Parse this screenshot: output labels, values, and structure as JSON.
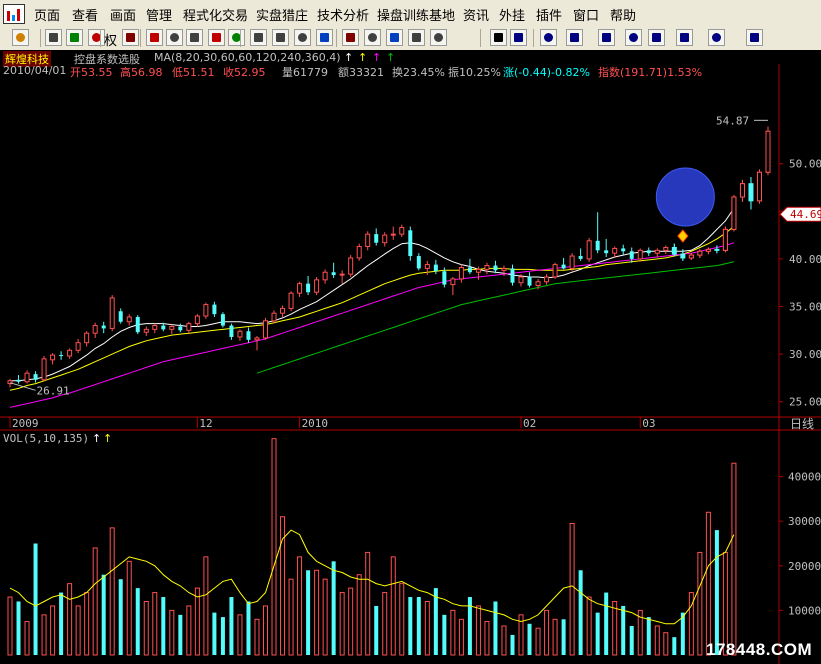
{
  "menu": [
    "页面",
    "查看",
    "画面",
    "管理",
    "程式化交易",
    "实盘猎庄",
    "技术分析",
    "操盘训练基地",
    "资讯",
    "外挂",
    "插件",
    "窗口",
    "帮助"
  ],
  "toolbar": {
    "quan_label": "权",
    "icons": [
      "open-folder-icon",
      "rsi-icon",
      "crosshair-icon",
      "arrows-icon",
      "weight-right-icon",
      "red-balls-icon",
      "glasses-icon",
      "number10-icon",
      "stop-icon",
      "flag-icon",
      "database-icon",
      "bar-chart-icon",
      "candlestick-icon",
      "info-icon",
      "worm-icon",
      "pen-icon",
      "grid-icon",
      "window-icon",
      "minimize-window-icon",
      "cursor-icon",
      "line-tool-icon",
      "text-tool-icon",
      "fib-tool-icon",
      "fan-tool-icon",
      "parallel-tool-icon",
      "channel-tool-icon",
      "rect-tool-icon",
      "ellipse-tool-icon",
      "more-tool-icon"
    ]
  },
  "header": {
    "stock_name": "辉煌科技",
    "indicator_name": "控盘系数选股",
    "ma_params": "MA(8,20,30,60,60,120,240,360,4)",
    "arrows": [
      "↑",
      "↑",
      "↑",
      "↑"
    ]
  },
  "info": {
    "date": "2010/04/01",
    "open": "开53.55",
    "high": "高56.98",
    "low": "低51.51",
    "close": "收52.95",
    "volume": "量61779",
    "amount": "额33321",
    "turnover": "换23.45%",
    "amplitude": "振10.25%",
    "change": "涨(-0.44)-0.82%",
    "index": "指数(191.71)1.53%"
  },
  "chart_data": {
    "type": "candlestick",
    "price_axis_ticks": [
      "50.00",
      "45.00",
      "40.00",
      "35.00",
      "30.00",
      "25.00"
    ],
    "price_ylim": [
      23.5,
      59
    ],
    "current_price_tag": "44.69",
    "high_label": "54.87",
    "low_label": "26.91",
    "date_labels": [
      "2009",
      "12",
      "2010",
      "02",
      "03"
    ],
    "period_label": "日线",
    "volume_title": "VOL(5,10,135)",
    "volume_arrows": [
      "↑",
      "↑"
    ],
    "volume_axis_ticks": [
      "40000",
      "30000",
      "20000",
      "10000"
    ],
    "volume_ylim": [
      0,
      50000
    ],
    "candles": [
      {
        "o": 26.9,
        "h": 27.4,
        "l": 26.5,
        "c": 27.2
      },
      {
        "o": 27.3,
        "h": 27.8,
        "l": 26.9,
        "c": 27.1
      },
      {
        "o": 27.1,
        "h": 28.3,
        "l": 26.9,
        "c": 28.0
      },
      {
        "o": 27.9,
        "h": 28.2,
        "l": 27.0,
        "c": 27.3
      },
      {
        "o": 27.3,
        "h": 29.8,
        "l": 27.2,
        "c": 29.5
      },
      {
        "o": 29.4,
        "h": 30.1,
        "l": 28.9,
        "c": 29.9
      },
      {
        "o": 29.9,
        "h": 30.3,
        "l": 29.4,
        "c": 29.8
      },
      {
        "o": 29.8,
        "h": 30.6,
        "l": 29.5,
        "c": 30.4
      },
      {
        "o": 30.4,
        "h": 31.6,
        "l": 30.1,
        "c": 31.2
      },
      {
        "o": 31.2,
        "h": 32.4,
        "l": 30.8,
        "c": 32.2
      },
      {
        "o": 32.2,
        "h": 33.3,
        "l": 31.7,
        "c": 33.0
      },
      {
        "o": 33.0,
        "h": 33.4,
        "l": 32.2,
        "c": 32.7
      },
      {
        "o": 32.7,
        "h": 36.2,
        "l": 32.4,
        "c": 35.9
      },
      {
        "o": 34.5,
        "h": 34.8,
        "l": 33.2,
        "c": 33.4
      },
      {
        "o": 33.4,
        "h": 34.2,
        "l": 33.0,
        "c": 33.9
      },
      {
        "o": 33.9,
        "h": 34.1,
        "l": 32.1,
        "c": 32.3
      },
      {
        "o": 32.3,
        "h": 32.9,
        "l": 31.9,
        "c": 32.6
      },
      {
        "o": 32.6,
        "h": 33.2,
        "l": 32.2,
        "c": 33.0
      },
      {
        "o": 33.0,
        "h": 33.3,
        "l": 32.4,
        "c": 32.6
      },
      {
        "o": 32.6,
        "h": 33.1,
        "l": 32.1,
        "c": 32.9
      },
      {
        "o": 32.9,
        "h": 33.2,
        "l": 32.3,
        "c": 32.5
      },
      {
        "o": 32.5,
        "h": 33.4,
        "l": 32.2,
        "c": 33.2
      },
      {
        "o": 33.2,
        "h": 34.2,
        "l": 32.9,
        "c": 34.0
      },
      {
        "o": 34.0,
        "h": 35.4,
        "l": 33.7,
        "c": 35.2
      },
      {
        "o": 35.2,
        "h": 35.5,
        "l": 33.9,
        "c": 34.2
      },
      {
        "o": 34.2,
        "h": 34.4,
        "l": 32.8,
        "c": 33.0
      },
      {
        "o": 33.0,
        "h": 33.2,
        "l": 31.5,
        "c": 31.8
      },
      {
        "o": 31.8,
        "h": 32.6,
        "l": 31.4,
        "c": 32.4
      },
      {
        "o": 32.4,
        "h": 32.8,
        "l": 31.2,
        "c": 31.5
      },
      {
        "o": 31.5,
        "h": 31.9,
        "l": 30.4,
        "c": 31.7
      },
      {
        "o": 31.7,
        "h": 33.8,
        "l": 31.5,
        "c": 33.5
      },
      {
        "o": 33.5,
        "h": 34.6,
        "l": 33.2,
        "c": 34.3
      },
      {
        "o": 34.3,
        "h": 35.1,
        "l": 33.9,
        "c": 34.8
      },
      {
        "o": 34.8,
        "h": 36.6,
        "l": 34.5,
        "c": 36.4
      },
      {
        "o": 36.4,
        "h": 37.6,
        "l": 36.0,
        "c": 37.4
      },
      {
        "o": 37.4,
        "h": 38.2,
        "l": 36.2,
        "c": 36.5
      },
      {
        "o": 36.5,
        "h": 38.1,
        "l": 36.2,
        "c": 37.8
      },
      {
        "o": 37.8,
        "h": 38.9,
        "l": 37.4,
        "c": 38.6
      },
      {
        "o": 38.6,
        "h": 39.6,
        "l": 38.0,
        "c": 38.3
      },
      {
        "o": 38.3,
        "h": 38.8,
        "l": 37.4,
        "c": 38.4
      },
      {
        "o": 38.4,
        "h": 40.4,
        "l": 38.1,
        "c": 40.1
      },
      {
        "o": 40.1,
        "h": 41.6,
        "l": 39.8,
        "c": 41.3
      },
      {
        "o": 41.3,
        "h": 42.9,
        "l": 40.9,
        "c": 42.6
      },
      {
        "o": 42.6,
        "h": 43.2,
        "l": 41.4,
        "c": 41.7
      },
      {
        "o": 41.7,
        "h": 42.8,
        "l": 41.3,
        "c": 42.5
      },
      {
        "o": 42.5,
        "h": 43.4,
        "l": 42.0,
        "c": 42.6
      },
      {
        "o": 42.6,
        "h": 43.6,
        "l": 42.3,
        "c": 43.3
      },
      {
        "o": 43.0,
        "h": 43.4,
        "l": 39.8,
        "c": 40.3
      },
      {
        "o": 40.3,
        "h": 40.6,
        "l": 38.8,
        "c": 39.0
      },
      {
        "o": 39.0,
        "h": 39.8,
        "l": 38.3,
        "c": 39.4
      },
      {
        "o": 39.4,
        "h": 39.9,
        "l": 38.4,
        "c": 38.7
      },
      {
        "o": 38.7,
        "h": 39.1,
        "l": 37.0,
        "c": 37.3
      },
      {
        "o": 37.3,
        "h": 38.1,
        "l": 36.2,
        "c": 37.9
      },
      {
        "o": 37.9,
        "h": 39.4,
        "l": 37.5,
        "c": 39.1
      },
      {
        "o": 39.1,
        "h": 40.0,
        "l": 38.4,
        "c": 38.6
      },
      {
        "o": 38.6,
        "h": 39.2,
        "l": 37.8,
        "c": 38.9
      },
      {
        "o": 38.9,
        "h": 39.6,
        "l": 38.4,
        "c": 39.3
      },
      {
        "o": 39.3,
        "h": 39.8,
        "l": 38.5,
        "c": 38.8
      },
      {
        "o": 38.8,
        "h": 39.3,
        "l": 38.2,
        "c": 39.0
      },
      {
        "o": 39.0,
        "h": 39.4,
        "l": 37.2,
        "c": 37.5
      },
      {
        "o": 37.5,
        "h": 38.4,
        "l": 37.1,
        "c": 38.1
      },
      {
        "o": 38.1,
        "h": 38.6,
        "l": 37.0,
        "c": 37.2
      },
      {
        "o": 37.2,
        "h": 37.9,
        "l": 36.8,
        "c": 37.6
      },
      {
        "o": 37.6,
        "h": 38.4,
        "l": 37.3,
        "c": 38.1
      },
      {
        "o": 38.1,
        "h": 39.6,
        "l": 37.9,
        "c": 39.4
      },
      {
        "o": 39.4,
        "h": 40.1,
        "l": 38.9,
        "c": 39.0
      },
      {
        "o": 39.0,
        "h": 40.6,
        "l": 38.7,
        "c": 40.3
      },
      {
        "o": 40.3,
        "h": 41.1,
        "l": 39.8,
        "c": 40.0
      },
      {
        "o": 40.0,
        "h": 42.2,
        "l": 39.7,
        "c": 41.9
      },
      {
        "o": 41.9,
        "h": 44.9,
        "l": 40.6,
        "c": 40.9
      },
      {
        "o": 40.9,
        "h": 42.1,
        "l": 40.2,
        "c": 40.6
      },
      {
        "o": 40.6,
        "h": 41.3,
        "l": 40.1,
        "c": 41.1
      },
      {
        "o": 41.1,
        "h": 41.5,
        "l": 40.4,
        "c": 40.8
      },
      {
        "o": 40.8,
        "h": 41.2,
        "l": 39.6,
        "c": 40.0
      },
      {
        "o": 40.0,
        "h": 41.1,
        "l": 39.7,
        "c": 40.9
      },
      {
        "o": 40.9,
        "h": 41.2,
        "l": 40.3,
        "c": 40.6
      },
      {
        "o": 40.6,
        "h": 41.1,
        "l": 40.2,
        "c": 40.9
      },
      {
        "o": 40.9,
        "h": 41.4,
        "l": 40.5,
        "c": 41.2
      },
      {
        "o": 41.2,
        "h": 41.6,
        "l": 40.3,
        "c": 40.5
      },
      {
        "o": 40.5,
        "h": 41.0,
        "l": 39.8,
        "c": 40.1
      },
      {
        "o": 40.1,
        "h": 40.6,
        "l": 39.9,
        "c": 40.4
      },
      {
        "o": 40.4,
        "h": 41.0,
        "l": 40.1,
        "c": 40.8
      },
      {
        "o": 40.8,
        "h": 41.2,
        "l": 40.5,
        "c": 41.0
      },
      {
        "o": 41.0,
        "h": 41.4,
        "l": 40.6,
        "c": 40.9
      },
      {
        "o": 40.9,
        "h": 43.4,
        "l": 40.7,
        "c": 43.1
      },
      {
        "o": 43.1,
        "h": 46.7,
        "l": 42.9,
        "c": 46.5
      },
      {
        "o": 46.5,
        "h": 48.3,
        "l": 46.0,
        "c": 47.9
      },
      {
        "o": 47.9,
        "h": 48.6,
        "l": 45.2,
        "c": 46.1
      },
      {
        "o": 46.1,
        "h": 49.4,
        "l": 45.8,
        "c": 49.1
      },
      {
        "o": 49.1,
        "h": 53.9,
        "l": 48.8,
        "c": 53.4
      }
    ],
    "ma_lines": [
      {
        "name": "MA8",
        "color": "#ffffff",
        "values": [
          27.2,
          27.2,
          27.3,
          27.4,
          27.6,
          27.9,
          28.3,
          28.7,
          29.3,
          29.9,
          30.6,
          31.1,
          31.8,
          32.4,
          32.8,
          33.1,
          33.2,
          33.2,
          33.2,
          33.1,
          33.0,
          32.9,
          32.9,
          33.0,
          33.2,
          33.4,
          33.4,
          33.4,
          33.3,
          33.2,
          33.3,
          33.5,
          33.8,
          34.2,
          34.7,
          35.1,
          35.5,
          36.1,
          36.7,
          37.3,
          37.9,
          38.6,
          39.3,
          39.9,
          40.5,
          41.1,
          41.6,
          41.7,
          41.5,
          41.1,
          40.6,
          40.1,
          39.7,
          39.4,
          39.2,
          38.9,
          38.7,
          38.6,
          38.5,
          38.3,
          38.2,
          38.1,
          38.1,
          38.0,
          38.1,
          38.3,
          38.6,
          38.9,
          39.3,
          39.6,
          39.9,
          40.2,
          40.4,
          40.6,
          40.7,
          40.8,
          40.8,
          40.8,
          40.8,
          40.8,
          40.9,
          41.4,
          42.2,
          43.1,
          44.0,
          45.3
        ]
      },
      {
        "name": "MA20",
        "color": "#ffff00",
        "values": [
          26.2,
          26.4,
          26.7,
          26.9,
          27.2,
          27.5,
          27.8,
          28.1,
          28.4,
          28.8,
          29.2,
          29.6,
          30.0,
          30.4,
          30.8,
          31.1,
          31.4,
          31.6,
          31.8,
          32.0,
          32.1,
          32.2,
          32.3,
          32.4,
          32.5,
          32.6,
          32.7,
          32.8,
          32.9,
          33.0,
          33.1,
          33.3,
          33.5,
          33.7,
          33.9,
          34.2,
          34.5,
          34.8,
          35.1,
          35.4,
          35.8,
          36.2,
          36.6,
          37.0,
          37.4,
          37.7,
          38.0,
          38.3,
          38.5,
          38.6,
          38.7,
          38.8,
          38.8,
          38.8,
          38.9,
          38.9,
          39.0,
          39.0,
          39.0,
          38.9,
          38.9,
          38.9,
          38.8,
          38.8,
          38.8,
          38.8,
          38.9,
          39.0,
          39.1,
          39.2,
          39.4,
          39.5,
          39.6,
          39.7,
          39.8,
          39.9,
          40.0,
          40.1,
          40.3,
          40.5,
          40.8,
          41.2,
          41.6,
          42.1,
          42.7,
          43.4
        ]
      },
      {
        "name": "MA60",
        "color": "#ff00ff",
        "values": [
          24.4,
          24.6,
          24.8,
          25.0,
          25.2,
          25.4,
          25.7,
          25.9,
          26.2,
          26.5,
          26.8,
          27.1,
          27.4,
          27.7,
          28.0,
          28.3,
          28.6,
          28.9,
          29.2,
          29.4,
          29.6,
          29.8,
          30.0,
          30.2,
          30.4,
          30.6,
          30.8,
          31.0,
          31.2,
          31.4,
          31.6,
          31.9,
          32.2,
          32.5,
          32.8,
          33.1,
          33.4,
          33.7,
          34.0,
          34.3,
          34.6,
          34.9,
          35.2,
          35.5,
          35.8,
          36.1,
          36.4,
          36.7,
          37.0,
          37.2,
          37.4,
          37.6,
          37.8,
          37.9,
          38.0,
          38.1,
          38.2,
          38.3,
          38.4,
          38.5,
          38.6,
          38.7,
          38.8,
          38.9,
          39.0,
          39.1,
          39.2,
          39.3,
          39.4,
          39.5,
          39.6,
          39.7,
          39.8,
          39.9,
          40.0,
          40.1,
          40.2,
          40.3,
          40.4,
          40.5,
          40.6,
          40.8,
          41.0,
          41.2,
          41.4,
          41.7
        ]
      },
      {
        "name": "MA120",
        "color": "#00c000",
        "start": 29,
        "values": [
          28.0,
          28.3,
          28.6,
          28.9,
          29.2,
          29.5,
          29.8,
          30.1,
          30.4,
          30.7,
          31.0,
          31.3,
          31.6,
          31.9,
          32.2,
          32.5,
          32.8,
          33.1,
          33.4,
          33.7,
          34.0,
          34.3,
          34.6,
          34.9,
          35.2,
          35.4,
          35.6,
          35.8,
          36.0,
          36.2,
          36.4,
          36.6,
          36.8,
          37.0,
          37.2,
          37.4,
          37.5,
          37.6,
          37.7,
          37.8,
          37.9,
          38.0,
          38.1,
          38.2,
          38.3,
          38.4,
          38.5,
          38.6,
          38.7,
          38.8,
          38.9,
          39.0,
          39.1,
          39.2,
          39.3,
          39.5,
          39.7
        ]
      }
    ],
    "volume": [
      13000,
      12000,
      7500,
      25000,
      9000,
      11000,
      14000,
      16000,
      11000,
      14000,
      24000,
      18000,
      28500,
      17000,
      21000,
      15000,
      12000,
      14000,
      13000,
      10000,
      9000,
      11000,
      15000,
      22000,
      9500,
      8500,
      13000,
      9000,
      12000,
      8000,
      11000,
      48500,
      31000,
      17000,
      22000,
      19000,
      19000,
      17000,
      21000,
      14000,
      15000,
      18000,
      23000,
      11000,
      14000,
      22000,
      16000,
      13000,
      13000,
      12000,
      15000,
      9000,
      10000,
      8000,
      13000,
      11000,
      7500,
      12000,
      6500,
      4500,
      9000,
      7000,
      6000,
      10000,
      8000,
      8000,
      29500,
      19000,
      13000,
      9500,
      14000,
      12000,
      11000,
      6500,
      10000,
      8500,
      6500,
      5000,
      4000,
      9500,
      14000,
      23000,
      32000,
      28000,
      23000,
      43000
    ],
    "vol_ma": [
      15000,
      14000,
      12000,
      11000,
      12000,
      13000,
      13500,
      12500,
      13000,
      14000,
      16000,
      17500,
      19000,
      20500,
      22000,
      21500,
      21000,
      20000,
      18000,
      16500,
      15500,
      14000,
      13000,
      13500,
      15000,
      16500,
      17000,
      14000,
      11500,
      12000,
      14000,
      20000,
      26000,
      28000,
      27000,
      23000,
      21000,
      20000,
      19000,
      18500,
      17500,
      17000,
      17000,
      16000,
      15500,
      16000,
      16500,
      15500,
      14500,
      14000,
      13000,
      12500,
      11500,
      11000,
      11000,
      10500,
      10000,
      9500,
      9000,
      8000,
      7500,
      8000,
      9000,
      11000,
      13000,
      15000,
      15500,
      14000,
      12500,
      11500,
      11000,
      10500,
      10000,
      9500,
      8500,
      8000,
      7500,
      7000,
      7000,
      8500,
      11000,
      15500,
      20000,
      22000,
      23000,
      27000
    ],
    "highlight_circle": {
      "center_index": 80,
      "center_price": 46.5
    }
  }
}
